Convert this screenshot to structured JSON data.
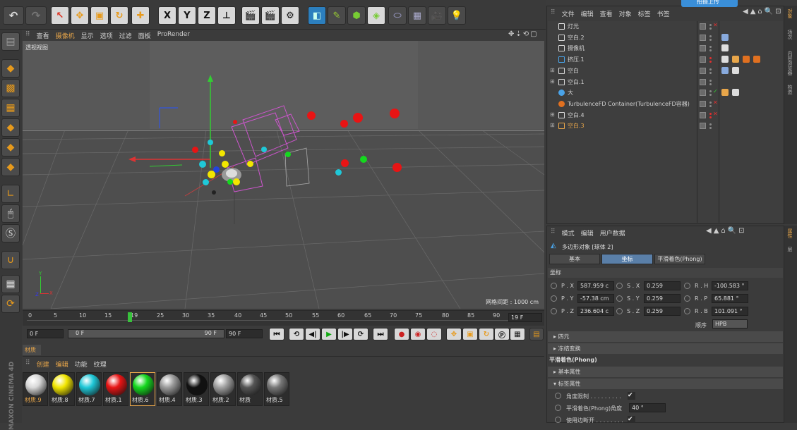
{
  "toolbar": {
    "xyz": [
      "X",
      "Y",
      "Z"
    ]
  },
  "viewport": {
    "menu": [
      "查看",
      "摄像机",
      "显示",
      "选项",
      "过滤",
      "面板",
      "ProRender"
    ],
    "active_menu": "摄像机",
    "label": "透视视图",
    "grid_spacing": "网格间距 : 1000 cm",
    "axis_y": "Y",
    "axis_z": "Z",
    "axis_x": "X"
  },
  "timeline": {
    "ticks": [
      "0",
      "5",
      "10",
      "15",
      "19",
      "25",
      "30",
      "35",
      "40",
      "45",
      "50",
      "55",
      "60",
      "65",
      "70",
      "75",
      "80",
      "85",
      "90"
    ],
    "current_frame": "19 F",
    "start_field": "0 F",
    "range_start": "0 F",
    "range_end": "90 F",
    "end_field": "90 F"
  },
  "materials": {
    "tab": "材质",
    "menu": [
      "创建",
      "编辑",
      "功能",
      "纹理"
    ],
    "items": [
      {
        "label": "材质.9",
        "color": "#d8d8d8"
      },
      {
        "label": "材质.8",
        "color": "#f2e600"
      },
      {
        "label": "材质.7",
        "color": "#1fc8d8"
      },
      {
        "label": "材质.1",
        "color": "#e81414"
      },
      {
        "label": "材质.6",
        "color": "#14d81e"
      },
      {
        "label": "材质.4",
        "color": "#9a9a9a"
      },
      {
        "label": "材质.3",
        "color": "#111111"
      },
      {
        "label": "材质.2",
        "color": "#a0a0a0"
      },
      {
        "label": "材质",
        "color": "#555555"
      },
      {
        "label": "材质.5",
        "color": "#777777"
      }
    ]
  },
  "object_manager": {
    "menu": [
      "文件",
      "编辑",
      "查看",
      "对象",
      "标签",
      "书签"
    ],
    "upload_btn": "拍摄上传",
    "rows": [
      {
        "name": "灯光",
        "color": "#d0d0d0"
      },
      {
        "name": "空白.2",
        "color": "#d0d0d0"
      },
      {
        "name": "摄像机",
        "color": "#d0d0d0"
      },
      {
        "name": "挤压.1",
        "color": "#d0d0d0"
      },
      {
        "name": "空白",
        "color": "#d0d0d0"
      },
      {
        "name": "空白.1",
        "color": "#d0d0d0"
      },
      {
        "name": "大",
        "color": "#d0d0d0"
      },
      {
        "name": "TurbulenceFD Container(TurbulenceFD容器)",
        "color": "#d0d0d0"
      },
      {
        "name": "空白.4",
        "color": "#d0d0d0"
      },
      {
        "name": "空白.3",
        "color": "#e8a64a"
      }
    ],
    "side_tabs": [
      "对象",
      "场次",
      "内容浏览器",
      "构造"
    ]
  },
  "attributes": {
    "menu": [
      "模式",
      "编辑",
      "用户数据"
    ],
    "title": "多边形对象 [球体 2]",
    "tabs": [
      "基本",
      "坐标",
      "平滑着色(Phong)"
    ],
    "active_tab": "坐标",
    "section": "坐标",
    "coords": [
      {
        "l1": "P . X",
        "v1": "587.959 c",
        "l2": "S . X",
        "v2": "0.259",
        "l3": "R . H",
        "v3": "-100.583 °"
      },
      {
        "l1": "P . Y",
        "v1": "-57.38 cm",
        "l2": "S . Y",
        "v2": "0.259",
        "l3": "R . P",
        "v3": "65.881 °"
      },
      {
        "l1": "P . Z",
        "v1": "236.604 c",
        "l2": "S . Z",
        "v2": "0.259",
        "l3": "R . B",
        "v3": "101.091 °"
      }
    ],
    "order_label": "顺序",
    "order_value": "HPB",
    "quaternion": "四元",
    "freeze": "冻结变换",
    "phong_header": "平滑着色(Phong)",
    "basic_props": "基本属性",
    "tag_props": "标签属性",
    "angle_limit": "角度限制 . . . . . . . . .",
    "phong_angle": "平滑着色(Phong)角度",
    "phong_angle_value": "40 °",
    "use_edge": "使用边断开 . . . . . . . .",
    "side_tabs": [
      "属性",
      "层"
    ]
  },
  "brand": "MAXON CINEMA 4D"
}
